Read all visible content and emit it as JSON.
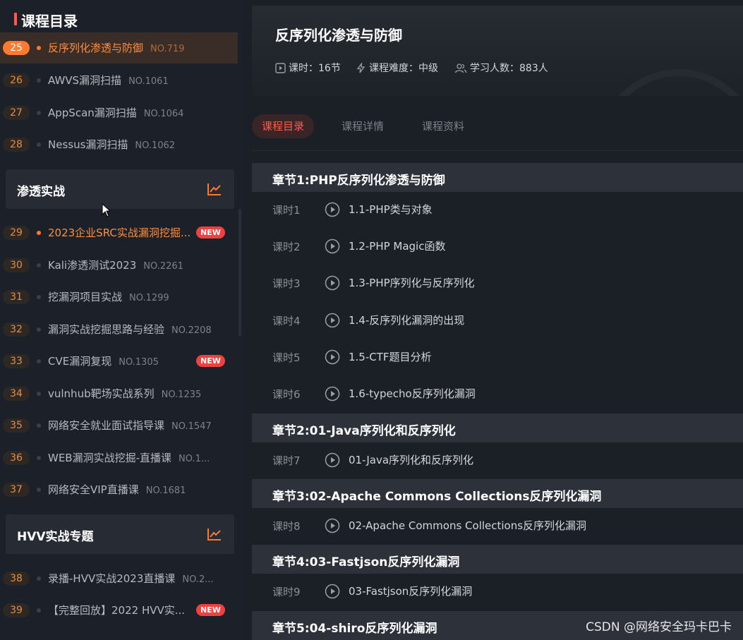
{
  "sidebar": {
    "title": "课程目录",
    "group1": [
      {
        "num": "25",
        "name": "反序列化渗透与防御",
        "no": "NO.719"
      },
      {
        "num": "26",
        "name": "AWVS漏洞扫描",
        "no": "NO.1061"
      },
      {
        "num": "27",
        "name": "AppScan漏洞扫描",
        "no": "NO.1064"
      },
      {
        "num": "28",
        "name": "Nessus漏洞扫描",
        "no": "NO.1062"
      }
    ],
    "section2": "渗透实战",
    "group2": [
      {
        "num": "29",
        "name": "2023企业SRC实战漏洞挖掘...",
        "no": "",
        "badge": "NEW"
      },
      {
        "num": "30",
        "name": "Kali渗透测试2023",
        "no": "NO.2261"
      },
      {
        "num": "31",
        "name": "挖漏洞项目实战",
        "no": "NO.1299"
      },
      {
        "num": "32",
        "name": "漏洞实战挖掘思路与经验",
        "no": "NO.2208"
      },
      {
        "num": "33",
        "name": "CVE漏洞复现",
        "no": "NO.1305",
        "badge": "NEW"
      },
      {
        "num": "34",
        "name": "vulnhub靶场实战系列",
        "no": "NO.1235"
      },
      {
        "num": "35",
        "name": "网络安全就业面试指导课",
        "no": "NO.1547"
      },
      {
        "num": "36",
        "name": "WEB漏洞实战挖掘-直播课",
        "no": "NO.1..."
      },
      {
        "num": "37",
        "name": "网络安全VIP直播课",
        "no": "NO.1681"
      }
    ],
    "section3": "HVV实战专题",
    "group3": [
      {
        "num": "38",
        "name": "录播-HVV实战2023直播课",
        "no": "NO.2..."
      },
      {
        "num": "39",
        "name": "【完整回放】2022 HVV实...",
        "no": "",
        "badge": "NEW"
      }
    ]
  },
  "course": {
    "title": "反序列化渗透与防御",
    "lessons_meta": "课时：16节",
    "difficulty_meta": "课程难度：中级",
    "learners_meta": "学习人数：883人"
  },
  "tabs": [
    "课程目录",
    "课程详情",
    "课程资料"
  ],
  "chapters": [
    {
      "title": "章节1:PHP反序列化渗透与防御",
      "lessons": [
        {
          "no": "课时1",
          "title": "1.1-PHP类与对象"
        },
        {
          "no": "课时2",
          "title": "1.2-PHP Magic函数"
        },
        {
          "no": "课时3",
          "title": "1.3-PHP序列化与反序列化"
        },
        {
          "no": "课时4",
          "title": "1.4-反序列化漏洞的出现"
        },
        {
          "no": "课时5",
          "title": "1.5-CTF题目分析"
        },
        {
          "no": "课时6",
          "title": "1.6-typecho反序列化漏洞"
        }
      ]
    },
    {
      "title": "章节2:01-Java序列化和反序列化",
      "lessons": [
        {
          "no": "课时7",
          "title": "01-Java序列化和反序列化"
        }
      ]
    },
    {
      "title": "章节3:02-Apache Commons Collections反序列化漏洞",
      "lessons": [
        {
          "no": "课时8",
          "title": "02-Apache Commons Collections反序列化漏洞"
        }
      ]
    },
    {
      "title": "章节4:03-Fastjson反序列化漏洞",
      "lessons": [
        {
          "no": "课时9",
          "title": "03-Fastjson反序列化漏洞"
        }
      ]
    },
    {
      "title": "章节5:04-shiro反序列化漏洞",
      "lessons": []
    }
  ],
  "watermark": "CSDN @网络安全玛卡巴卡",
  "colors": {
    "accent": "#ff7a2e",
    "active_tab": "#ff5a4e",
    "badge": "#f0413f"
  }
}
